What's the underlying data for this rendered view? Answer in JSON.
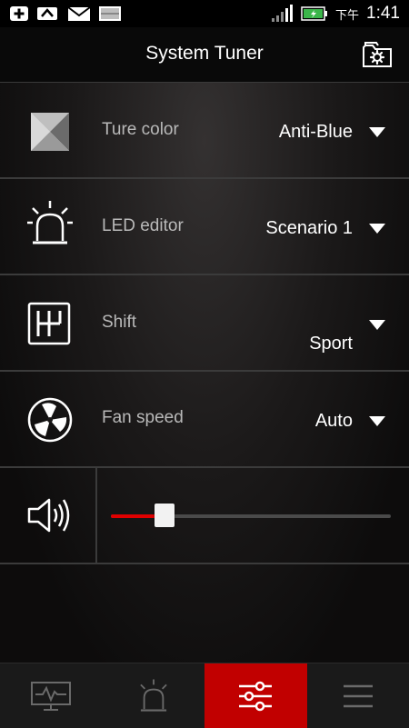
{
  "status_bar": {
    "time": "1:41",
    "ampm": "下午",
    "icons": [
      "add-icon",
      "sync-icon",
      "mail-icon",
      "image-icon",
      "signal-icon",
      "battery-charging-icon"
    ]
  },
  "app_bar": {
    "title": "System Tuner",
    "settings_icon": "folder-gear-icon"
  },
  "rows": [
    {
      "label": "Ture color",
      "value": "Anti-Blue",
      "icon": "true-color-icon"
    },
    {
      "label": "LED editor",
      "value": "Scenario 1",
      "icon": "led-siren-icon"
    },
    {
      "label": "Shift",
      "value": "Sport",
      "icon": "gear-shift-icon"
    },
    {
      "label": "Fan speed",
      "value": "Auto",
      "icon": "fan-icon"
    }
  ],
  "volume": {
    "icon": "speaker-icon",
    "level": 0.19
  },
  "bottom_nav": {
    "active_index": 2,
    "tabs": [
      "monitor-icon",
      "led-siren-icon",
      "sliders-icon",
      "menu-icon"
    ]
  },
  "colors": {
    "accent": "#c10000",
    "slider_fill": "#e00000"
  }
}
